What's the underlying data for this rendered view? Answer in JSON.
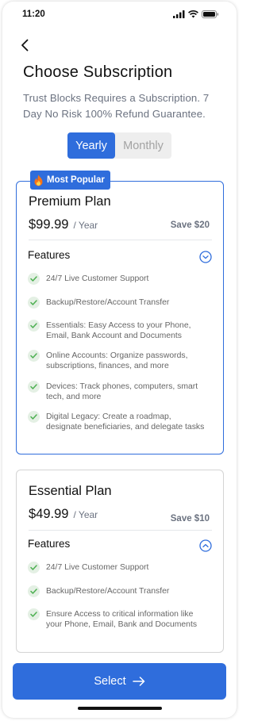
{
  "status": {
    "time": "11:20"
  },
  "header": {
    "title": "Choose Subscription",
    "subtitle": "Trust Blocks Requires a Subscription. 7 Day No Risk 100% Refund Guarantee."
  },
  "billing_toggle": {
    "yearly": "Yearly",
    "monthly": "Monthly",
    "selected": "Yearly"
  },
  "plans": [
    {
      "badge": "Most Popular",
      "name": "Premium Plan",
      "price": "$99.99",
      "period": "/ Year",
      "save": "Save $20",
      "features_label": "Features",
      "features": [
        "24/7 Live Customer Support",
        "Backup/Restore/Account Transfer",
        "Essentials: Easy Access to your Phone, Email, Bank Account and Documents",
        "Online Accounts: Organize passwords, subscriptions, finances, and more",
        "Devices: Track phones, computers, smart tech, and more",
        "Digital Legacy: Create a roadmap, designate beneficiaries, and delegate tasks"
      ]
    },
    {
      "name": "Essential Plan",
      "price": "$49.99",
      "period": "/ Year",
      "save": "Save $10",
      "features_label": "Features",
      "features": [
        "24/7 Live Customer Support",
        "Backup/Restore/Account Transfer",
        "Ensure Access to critical information like your Phone, Email, Bank and Documents"
      ]
    }
  ],
  "select_button": {
    "label": "Select"
  },
  "colors": {
    "accent": "#2f6ddc",
    "check_bg": "#e4f0e4",
    "check_mark": "#4caf50"
  }
}
